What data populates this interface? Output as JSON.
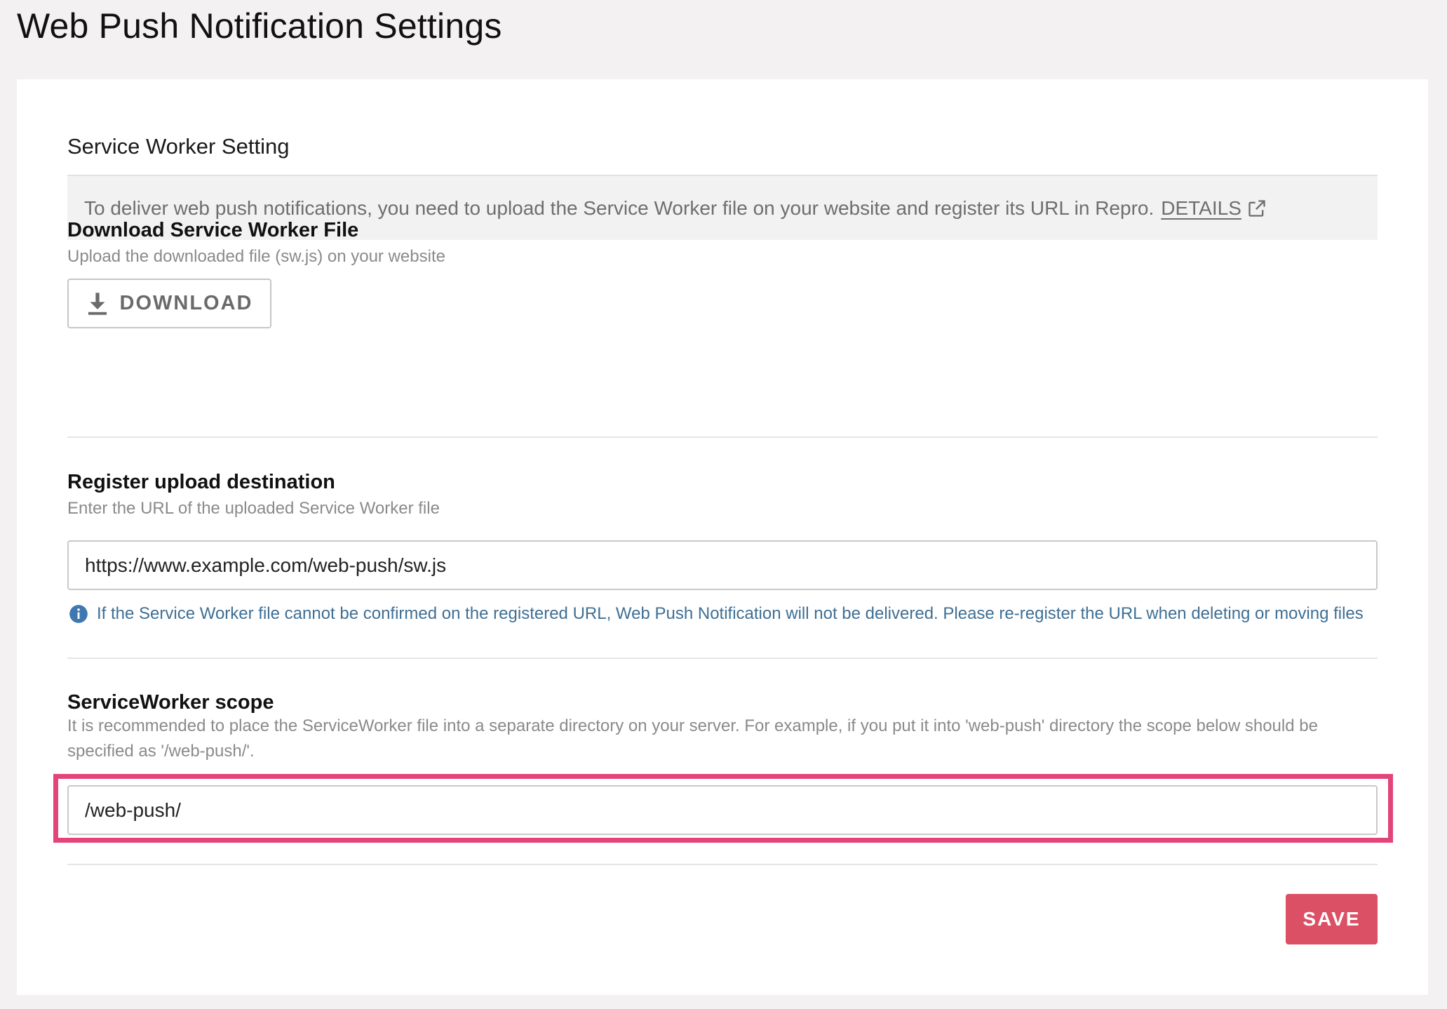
{
  "page": {
    "title": "Web Push Notification Settings"
  },
  "service_worker": {
    "heading": "Service Worker Setting",
    "info_text": "To deliver web push notifications, you need to upload the Service Worker file on your website and register its URL in Repro.",
    "details_link": "DETAILS",
    "details_icon": "external-link-icon"
  },
  "download_section": {
    "title": "Download Service Worker File",
    "help": "Upload the downloaded file (sw.js) on your website",
    "button_label": "DOWNLOAD",
    "button_icon": "download-icon"
  },
  "register_section": {
    "title": "Register upload destination",
    "help": "Enter the URL of the uploaded Service Worker file",
    "url_value": "https://www.example.com/web-push/sw.js",
    "notice_icon": "info-icon",
    "notice": "If the Service Worker file cannot be confirmed on the registered URL, Web Push Notification will not be delivered. Please re-register the URL when deleting or moving files"
  },
  "scope_section": {
    "title": "ServiceWorker scope",
    "help": "It is recommended to place the ServiceWorker file into a separate directory on your server. For example, if you put it into 'web-push' directory the scope below should be specified as '/web-push/'.",
    "scope_value": "/web-push/"
  },
  "actions": {
    "save_label": "SAVE"
  },
  "colors": {
    "highlight": "#e3457a",
    "save_button": "#dc5065",
    "notice_text": "#3f6f94"
  }
}
